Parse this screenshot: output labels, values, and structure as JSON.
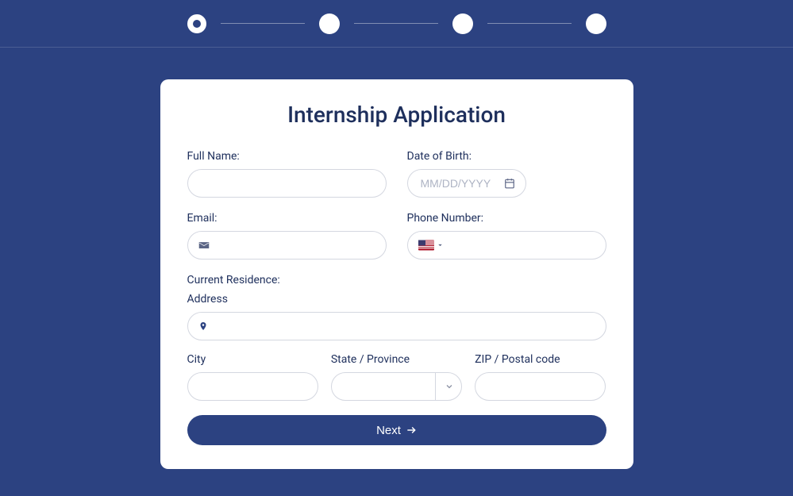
{
  "stepper": {
    "total": 4,
    "current": 1
  },
  "form": {
    "title": "Internship Application",
    "fields": {
      "full_name": {
        "label": "Full Name:",
        "value": ""
      },
      "dob": {
        "label": "Date of Birth:",
        "placeholder": "MM/DD/YYYY",
        "value": ""
      },
      "email": {
        "label": "Email:",
        "value": ""
      },
      "phone": {
        "label": "Phone Number:",
        "value": "",
        "country": "US"
      },
      "residence": {
        "section_label": "Current Residence:",
        "address": {
          "label": "Address",
          "value": ""
        },
        "city": {
          "label": "City",
          "value": ""
        },
        "state": {
          "label": "State / Province",
          "value": ""
        },
        "zip": {
          "label": "ZIP / Postal code",
          "value": ""
        }
      }
    },
    "next_button": "Next"
  },
  "colors": {
    "primary": "#2c4281",
    "text": "#1e2f5c"
  }
}
